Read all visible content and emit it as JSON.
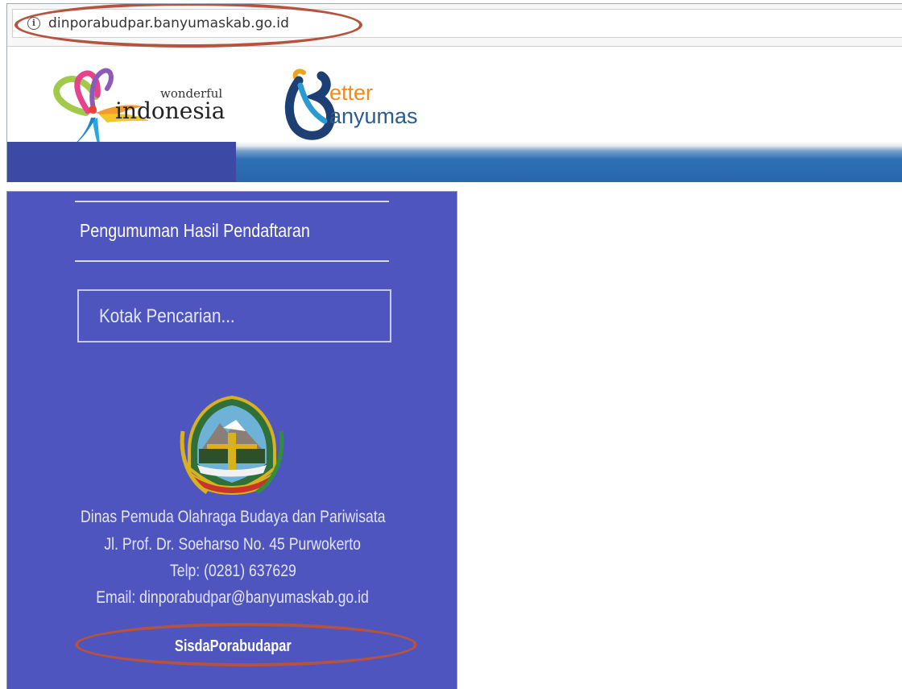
{
  "browser": {
    "url": "dinporabudpar.banyumaskab.go.id",
    "info_icon": "info-icon"
  },
  "header": {
    "logo_wonderful": {
      "small": "wonderful",
      "big": "indonesia"
    },
    "logo_better": {
      "top": "etter",
      "bottom": "anyumas"
    },
    "colors": {
      "nav_left": "#3c4aa6",
      "nav_bar": "#2866ad"
    }
  },
  "sidebar": {
    "announcement_link": "Pengumuman Hasil Pendaftaran",
    "search": {
      "placeholder": "Kotak Pencarian..."
    },
    "seal_icon": "banyumas-regency-seal-icon",
    "footer": {
      "org": "Dinas Pemuda Olahraga Budaya dan Pariwisata",
      "address": "Jl. Prof. Dr. Soeharso No. 45 Purwokerto",
      "phone": "Telp: (0281) 637629",
      "email": "Email: dinporabudpar@banyumaskab.go.id"
    },
    "brand_link": "SisdaPorabudapar",
    "colors": {
      "background": "#4f55bf",
      "highlight": "#b5533f"
    }
  }
}
